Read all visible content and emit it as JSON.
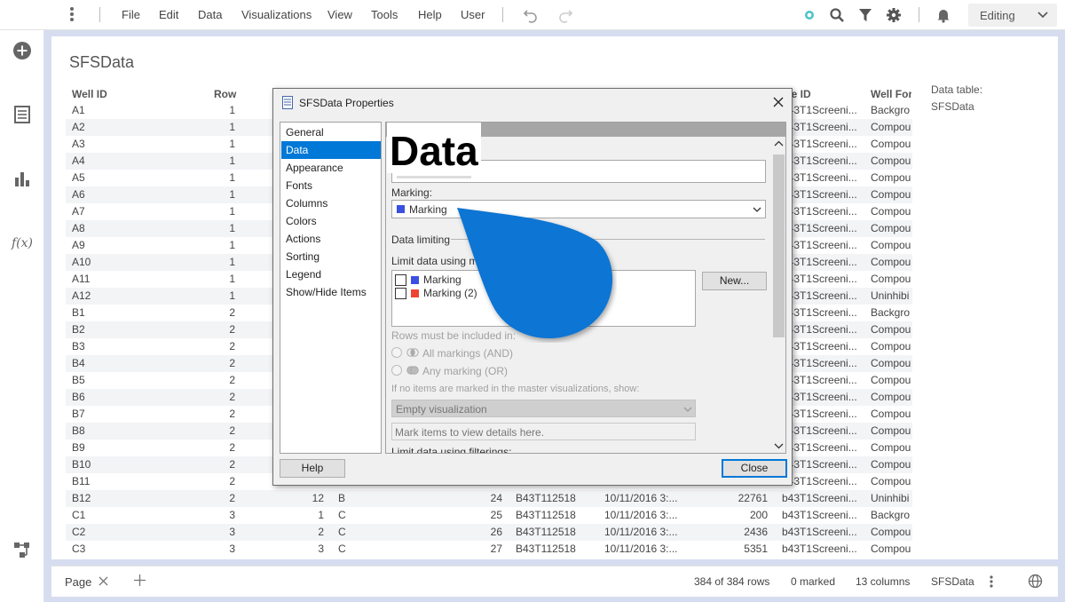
{
  "menubar": {
    "items": [
      "File",
      "Edit",
      "Data",
      "Visualizations",
      "View",
      "Tools",
      "Help",
      "User"
    ],
    "mode_label": "Editing"
  },
  "visualization": {
    "title": "SFSData",
    "columns": [
      "Well ID",
      "Row",
      "ate ID",
      "Well For"
    ],
    "rows": [
      [
        "A1",
        "1",
        "",
        "",
        "",
        "",
        "",
        "",
        "b43T1Screeni...",
        "Backgro"
      ],
      [
        "A2",
        "1",
        "",
        "",
        "",
        "",
        "",
        "",
        "b43T1Screeni...",
        "Compou"
      ],
      [
        "A3",
        "1",
        "",
        "",
        "",
        "",
        "",
        "",
        "b43T1Screeni...",
        "Compou"
      ],
      [
        "A4",
        "1",
        "",
        "",
        "",
        "",
        "",
        "",
        "b43T1Screeni...",
        "Compou"
      ],
      [
        "A5",
        "1",
        "",
        "",
        "",
        "",
        "",
        "",
        "b43T1Screeni...",
        "Compou"
      ],
      [
        "A6",
        "1",
        "",
        "",
        "",
        "",
        "",
        "",
        "b43T1Screeni...",
        "Compou"
      ],
      [
        "A7",
        "1",
        "",
        "",
        "",
        "",
        "",
        "",
        "b43T1Screeni...",
        "Compou"
      ],
      [
        "A8",
        "1",
        "",
        "",
        "",
        "",
        "",
        "",
        "b43T1Screeni...",
        "Compou"
      ],
      [
        "A9",
        "1",
        "",
        "",
        "",
        "",
        "",
        "",
        "b43T1Screeni...",
        "Compou"
      ],
      [
        "A10",
        "1",
        "",
        "",
        "",
        "",
        "",
        "",
        "b43T1Screeni...",
        "Compou"
      ],
      [
        "A11",
        "1",
        "",
        "",
        "",
        "",
        "",
        "",
        "b43T1Screeni...",
        "Compou"
      ],
      [
        "A12",
        "1",
        "",
        "",
        "",
        "",
        "",
        "",
        "b43T1Screeni...",
        "Uninhibi"
      ],
      [
        "B1",
        "2",
        "",
        "",
        "",
        "",
        "",
        "",
        "b43T1Screeni...",
        "Backgro"
      ],
      [
        "B2",
        "2",
        "",
        "",
        "",
        "",
        "",
        "",
        "b43T1Screeni...",
        "Compou"
      ],
      [
        "B3",
        "2",
        "",
        "",
        "",
        "",
        "",
        "",
        "b43T1Screeni...",
        "Compou"
      ],
      [
        "B4",
        "2",
        "",
        "",
        "",
        "",
        "",
        "",
        "b43T1Screeni...",
        "Compou"
      ],
      [
        "B5",
        "2",
        "",
        "",
        "",
        "",
        "",
        "",
        "b43T1Screeni...",
        "Compou"
      ],
      [
        "B6",
        "2",
        "",
        "",
        "",
        "",
        "",
        "",
        "b43T1Screeni...",
        "Compou"
      ],
      [
        "B7",
        "2",
        "",
        "",
        "",
        "",
        "",
        "",
        "b43T1Screeni...",
        "Compou"
      ],
      [
        "B8",
        "2",
        "",
        "",
        "",
        "",
        "",
        "",
        "b43T1Screeni...",
        "Compou"
      ],
      [
        "B9",
        "2",
        "",
        "",
        "",
        "",
        "",
        "",
        "b43T1Screeni...",
        "Compou"
      ],
      [
        "B10",
        "2",
        "",
        "",
        "",
        "",
        "",
        "",
        "b43T1Screeni...",
        "Compou"
      ],
      [
        "B11",
        "2",
        "",
        "",
        "",
        "",
        "",
        "",
        "b43T1Screeni...",
        "Compou"
      ],
      [
        "B12",
        "2",
        "12",
        "B",
        "24",
        "B43T112518",
        "10/11/2016 3:...",
        "22761",
        "b43T1Screeni...",
        "Uninhibi"
      ],
      [
        "C1",
        "3",
        "1",
        "C",
        "25",
        "B43T112518",
        "10/11/2016 3:...",
        "200",
        "b43T1Screeni...",
        "Backgro"
      ],
      [
        "C2",
        "3",
        "2",
        "C",
        "26",
        "B43T112518",
        "10/11/2016 3:...",
        "2436",
        "b43T1Screeni...",
        "Compou"
      ],
      [
        "C3",
        "3",
        "3",
        "C",
        "27",
        "B43T112518",
        "10/11/2016 3:...",
        "5351",
        "b43T1Screeni...",
        "Compou"
      ]
    ],
    "side_label": "Data table:",
    "side_value": "SFSData"
  },
  "statusbar": {
    "page_tab": "Page",
    "rows": "384 of 384 rows",
    "marked": "0 marked",
    "columns": "13 columns",
    "table": "SFSData"
  },
  "dialog": {
    "title": "SFSData Properties",
    "nav": [
      "General",
      "Data",
      "Appearance",
      "Fonts",
      "Columns",
      "Colors",
      "Actions",
      "Sorting",
      "Legend",
      "Show/Hide Items"
    ],
    "selected_nav": "Data",
    "heading": "Data",
    "marking_label": "Marking:",
    "marking_value": "Marking",
    "marking_color": "#3b4fe0",
    "data_limiting": "Data limiting",
    "limit_by_marking": "Limit data using mark",
    "markings": [
      {
        "name": "Marking",
        "color": "#3b4fe0",
        "checked": false
      },
      {
        "name": "Marking (2)",
        "color": "#ee4433",
        "checked": false
      }
    ],
    "new_button": "New...",
    "rows_included": "Rows must be included in:",
    "all_markings": "All markings (AND)",
    "any_marking": "Any marking (OR)",
    "if_no_items": "If no items are marked in the master visualizations, show:",
    "empty_viz": "Empty visualization",
    "mark_items": "Mark items to view details here.",
    "limit_filterings": "Limit data using filterings:",
    "help_button": "Help",
    "close_button": "Close"
  },
  "colors": {
    "accent": "#0078d7",
    "page_background": "#d7ddf0"
  }
}
